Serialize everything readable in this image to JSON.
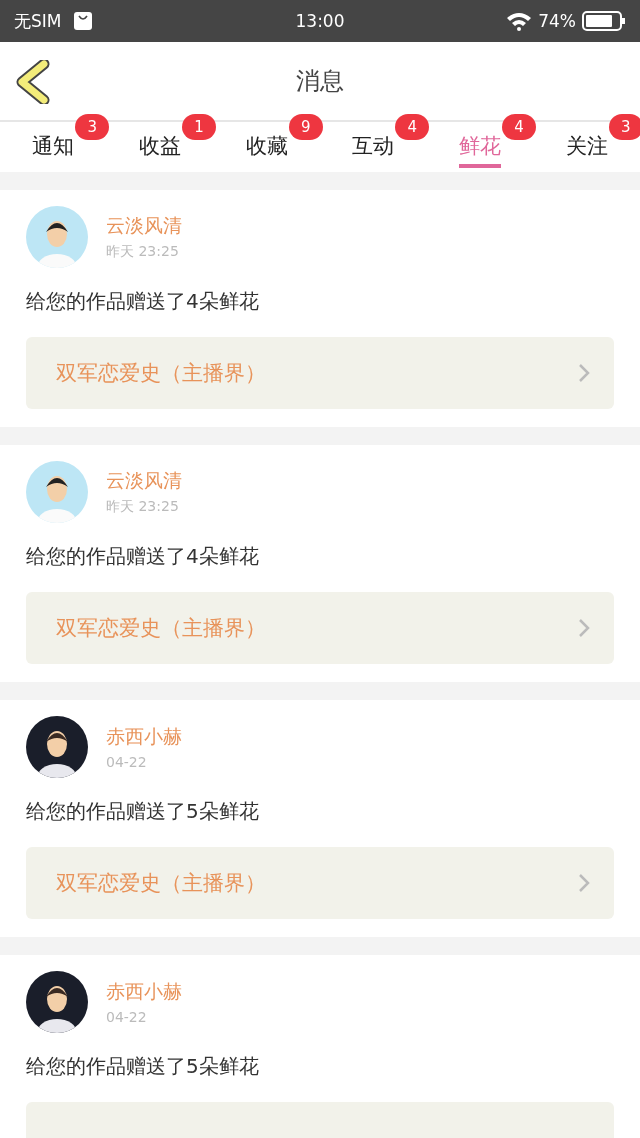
{
  "status_bar": {
    "carrier": "无SIM",
    "time": "13:00",
    "battery": "74%"
  },
  "header": {
    "title": "消息"
  },
  "tabs": [
    {
      "label": "通知",
      "badge": "3",
      "selected": false
    },
    {
      "label": "收益",
      "badge": "1",
      "selected": false
    },
    {
      "label": "收藏",
      "badge": "9",
      "selected": false
    },
    {
      "label": "互动",
      "badge": "4",
      "selected": false
    },
    {
      "label": "鲜花",
      "badge": "4",
      "selected": true
    },
    {
      "label": "关注",
      "badge": "3",
      "selected": false
    }
  ],
  "messages": [
    {
      "avatar": {
        "kind": "cartoon"
      },
      "name": "云淡风清",
      "time": "昨天 23:25",
      "text": "给您的作品赠送了4朵鲜花",
      "link": "双军恋爱史（主播界）"
    },
    {
      "avatar": {
        "kind": "cartoon"
      },
      "name": "云淡风清",
      "time": "昨天 23:25",
      "text": "给您的作品赠送了4朵鲜花",
      "link": "双军恋爱史（主播界）"
    },
    {
      "avatar": {
        "kind": "photo"
      },
      "name": "赤西小赫",
      "time": "04-22",
      "text": "给您的作品赠送了5朵鲜花",
      "link": "双军恋爱史（主播界）"
    },
    {
      "avatar": {
        "kind": "photo"
      },
      "name": "赤西小赫",
      "time": "04-22",
      "text": "给您的作品赠送了5朵鲜花"
    }
  ]
}
